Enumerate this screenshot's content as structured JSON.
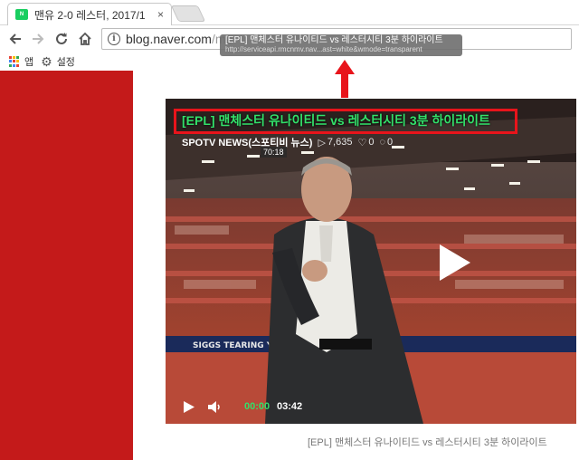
{
  "browser": {
    "tab": {
      "title": "맨유 2-0 레스터, 2017/1",
      "favicon": "N",
      "close": "×"
    },
    "url": {
      "host": "blog.naver.com",
      "path": "/me"
    },
    "bookmarks": [
      {
        "label": "앱",
        "icon": "apps-grid-icon"
      },
      {
        "label": "설정",
        "icon": "gear-icon"
      }
    ]
  },
  "tooltip": {
    "title": "[EPL] 맨체스터 유나이티드 vs 레스터시티 3분 하이라이트",
    "url": "http://serviceapi.rmcnmv.nav...ast=white&wmode=transparent"
  },
  "video": {
    "title": "[EPL] 맨체스터 유나이티드 vs 레스터시티 3분 하이라이트",
    "channel": "SPOTV NEWS(스포티비 뉴스)",
    "views": "7,635",
    "likes": "0",
    "comments": "0",
    "thumb_time": "70:18",
    "current_time": "00:00",
    "duration": "03:42",
    "banner": "SIGGS TEARING YOU APART"
  },
  "caption": "[EPL] 맨체스터 유나이티드 vs 레스터시티 3분 하이라이트",
  "colors": {
    "accent_red": "#c41a1a",
    "highlight_red": "#e8141b",
    "title_green": "#33e06a"
  }
}
